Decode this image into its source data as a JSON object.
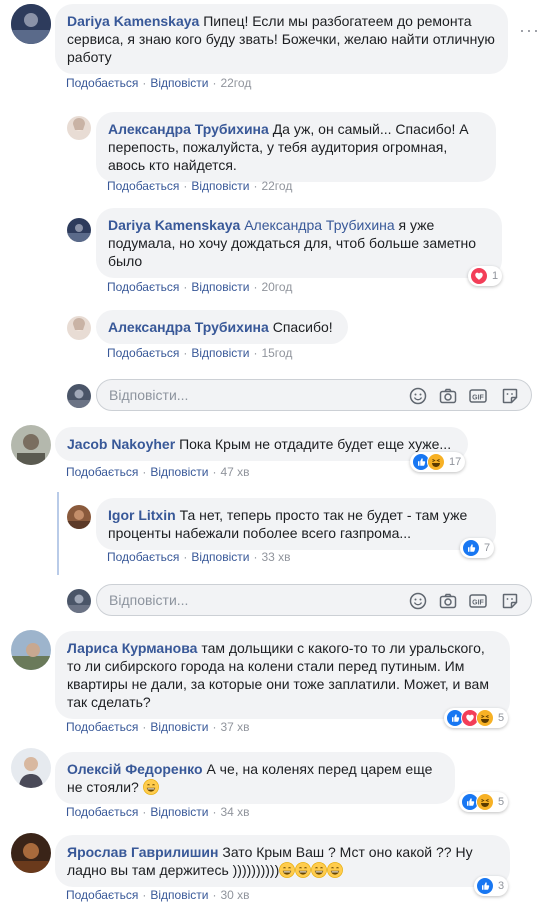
{
  "reply_placeholder": "Відповісти...",
  "actions": {
    "like": "Подобається",
    "reply": "Відповісти"
  },
  "comments": [
    {
      "name": "Dariya Kamenskaya",
      "text": "Пипец! Если мы разбогатеем до ремонта сервиса, я знаю кого буду звать! Божечки, желаю найти отличную работу",
      "time": "22год"
    },
    {
      "name": "Александра Трубихина",
      "text": "Да уж, он самый... Спасибо! А перепость, пожалуйста, у тебя аудитория огромная, авось кто найдется.",
      "time": "22год"
    },
    {
      "name": "Dariya Kamenskaya",
      "mention": "Александра Трубихина",
      "text": "я уже подумала, но хочу дождаться для, чтоб больше заметно было",
      "time": "20год",
      "reaction_count": "1"
    },
    {
      "name": "Александра Трубихина",
      "text": "Спасибо!",
      "time": "15год"
    },
    {
      "name": "Jacob Nakoyher",
      "text": "Пока Крым не отдадите будет еще хуже...",
      "time": "47 хв",
      "reaction_count": "17"
    },
    {
      "name": "Igor Litxin",
      "text": "Та нет, теперь просто так не будет - там уже проценты набежали поболее всего газпрома...",
      "time": "33 хв",
      "reaction_count": "7"
    },
    {
      "name": "Лариса Курманова",
      "text": "там дольщики с какого-то то ли уральского, то ли сибирского города на колени стали перед путиным. Им квартиры не дали, за которые они тоже заплатили. Может, и вам так сделать?",
      "time": "37 хв",
      "reaction_count": "5"
    },
    {
      "name": "Олексій Федоренко",
      "text": "А че, на коленях перед царем еще не стояли?",
      "time": "34 хв",
      "reaction_count": "5"
    },
    {
      "name": "Ярослав Гаврилишин",
      "text": "Зато Крым Ваш ? Мст оно какой ?? Ну ладно вы там держитесь ))))))))))",
      "time": "30 хв",
      "reaction_count": "3"
    }
  ]
}
